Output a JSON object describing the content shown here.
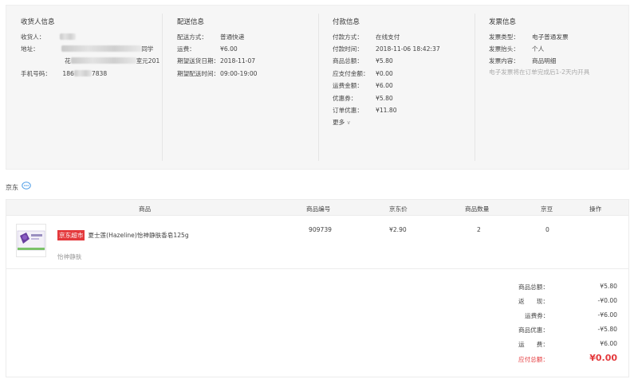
{
  "receiver": {
    "title": "收货人信息",
    "name_label": "收货人：",
    "name_value": "",
    "address_label": "地址：",
    "address_line1_end": "同学",
    "address_line2_start": "花",
    "address_line2_end": "室元201",
    "phone_label": "手机号码：",
    "phone_prefix": "186",
    "phone_suffix": "7838"
  },
  "delivery": {
    "title": "配送信息",
    "rows": [
      {
        "label": "配送方式：",
        "value": "普通快递"
      },
      {
        "label": "运费：",
        "value": "¥6.00"
      },
      {
        "label": "期望送货日期：",
        "value": "2018-11-07"
      },
      {
        "label": "期望配送时间：",
        "value": "09:00-19:00"
      }
    ]
  },
  "payment": {
    "title": "付款信息",
    "rows": [
      {
        "label": "付款方式：",
        "value": "在线支付"
      },
      {
        "label": "付款时间：",
        "value": "2018-11-06 18:42:37"
      },
      {
        "label": "商品总额：",
        "value": "¥5.80"
      },
      {
        "label": "应支付金额：",
        "value": "¥0.00"
      },
      {
        "label": "运费金额：",
        "value": "¥6.00"
      },
      {
        "label": "优惠券：",
        "value": "¥5.80"
      },
      {
        "label": "订单优惠：",
        "value": "¥11.80"
      }
    ],
    "more_label": "更多",
    "more_icon": "chevron-down-icon"
  },
  "invoice": {
    "title": "发票信息",
    "rows": [
      {
        "label": "发票类型：",
        "value": "电子普通发票"
      },
      {
        "label": "发票抬头：",
        "value": "个人"
      },
      {
        "label": "发票内容：",
        "value": "商品明细"
      }
    ],
    "note": "电子发票将在订单完成后1-2天内开具"
  },
  "shop": {
    "name": "京东",
    "chat_icon": "chat-bubble-icon"
  },
  "table": {
    "headers": [
      "商品",
      "商品编号",
      "京东价",
      "商品数量",
      "京豆",
      "操作"
    ],
    "items": [
      {
        "tag": "京东超市",
        "title": "夏士莲(Hazeline)怡神静肤香皂125g",
        "subtitle": "怡神静肤",
        "sku": "909739",
        "price": "¥2.90",
        "qty": "2",
        "beans": "0"
      }
    ]
  },
  "summary": {
    "rows": [
      {
        "label": "商品总额：",
        "value": "¥5.80"
      },
      {
        "label": "返　　现：",
        "value": "-¥0.00"
      },
      {
        "label": "运费券：",
        "value": "-¥6.00"
      },
      {
        "label": "商品优惠：",
        "value": "-¥5.80"
      },
      {
        "label": "运　　费：",
        "value": "¥6.00"
      }
    ],
    "total_label": "应付总额：",
    "total_value": "¥0.00",
    "accent_color": "#e4393c"
  }
}
